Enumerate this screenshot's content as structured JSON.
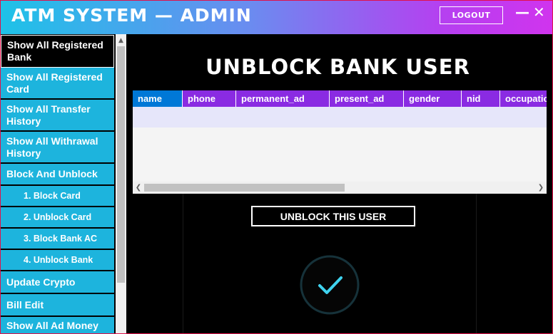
{
  "header": {
    "title": "ATM SYSTEM — ADMIN",
    "logout_label": "LOGOUT",
    "minimize_glyph": "—",
    "close_glyph": "✕"
  },
  "sidebar": {
    "items": [
      {
        "label": "Show All Registered Bank",
        "active": true
      },
      {
        "label": "Show All Registered Card"
      },
      {
        "label": "Show All Transfer History"
      },
      {
        "label": "Show All Withrawal History"
      },
      {
        "label": "Block And Unblock"
      },
      {
        "label": "1. Block Card"
      },
      {
        "label": "2. Unblock Card"
      },
      {
        "label": "3. Block Bank AC"
      },
      {
        "label": "4. Unblock Bank"
      },
      {
        "label": "Update Crypto"
      },
      {
        "label": "Bill Edit"
      },
      {
        "label": "Show All Ad Money"
      }
    ]
  },
  "main": {
    "title": "UNBLOCK BANK USER",
    "table": {
      "columns": [
        "name",
        "phone",
        "permanent_ad",
        "present_ad",
        "gender",
        "nid",
        "occupation"
      ],
      "rows": []
    },
    "unblock_label": "UNBLOCK THIS USER",
    "status_icon": "checkmark-circle-icon"
  },
  "colors": {
    "header_start": "#1ec2e8",
    "header_end": "#d034ee",
    "sidebar_bg": "#1db4dd",
    "table_header": "#8a2be2",
    "table_header_first": "#0078d7",
    "check_accent": "#3fd3ef"
  }
}
